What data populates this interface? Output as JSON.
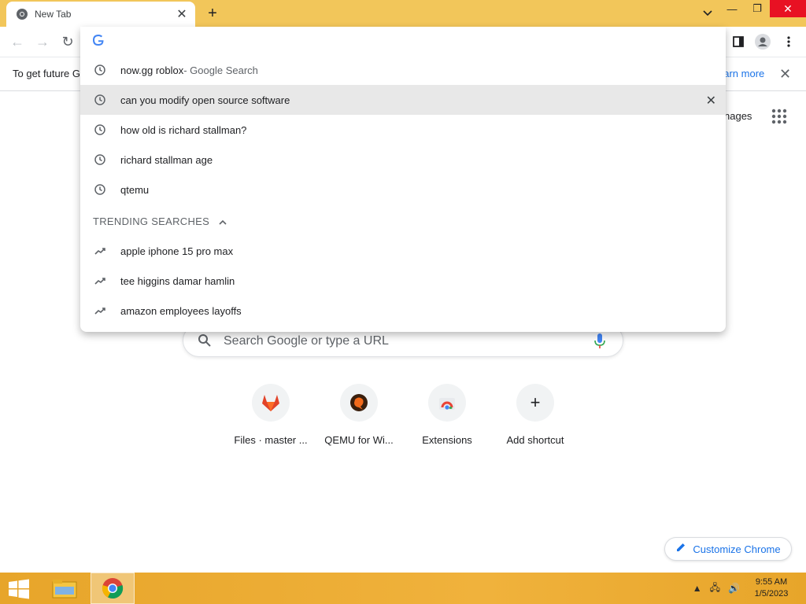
{
  "browser": {
    "tab": {
      "title": "New Tab"
    },
    "window_controls": [
      "minimize",
      "restore",
      "close"
    ]
  },
  "infobar": {
    "text": "To get future G",
    "link": "earn more"
  },
  "ntp": {
    "images_link": "nages",
    "search_placeholder": "Search Google or type a URL",
    "shortcuts": [
      {
        "label": "Files · master ...",
        "icon": "gitlab-icon"
      },
      {
        "label": "QEMU for Wi...",
        "icon": "qemu-icon"
      },
      {
        "label": "Extensions",
        "icon": "chrome-web-store-icon"
      },
      {
        "label": "Add shortcut",
        "icon": "plus-icon"
      }
    ],
    "customize_label": "Customize Chrome"
  },
  "omnibox": {
    "input_value": "",
    "suggestions": [
      {
        "text": "now.gg roblox",
        "suffix": " - Google Search",
        "icon": "history-icon"
      },
      {
        "text": "can you modify open source software",
        "icon": "history-icon",
        "selected": true
      },
      {
        "text": "how old is richard stallman?",
        "icon": "history-icon"
      },
      {
        "text": "richard stallman age",
        "icon": "history-icon"
      },
      {
        "text": "qtemu",
        "icon": "history-icon"
      }
    ],
    "trending_header": "TRENDING SEARCHES",
    "trending": [
      {
        "text": "apple iphone 15 pro max",
        "icon": "trending-icon"
      },
      {
        "text": "tee higgins damar hamlin",
        "icon": "trending-icon"
      },
      {
        "text": "amazon employees layoffs",
        "icon": "trending-icon"
      }
    ]
  },
  "taskbar": {
    "time": "9:55 AM",
    "date": "1/5/2023"
  },
  "colors": {
    "title_bar": "#f2c65a",
    "taskbar": "#e7a52a",
    "link_blue": "#1a73e8",
    "close_red": "#e81123"
  }
}
